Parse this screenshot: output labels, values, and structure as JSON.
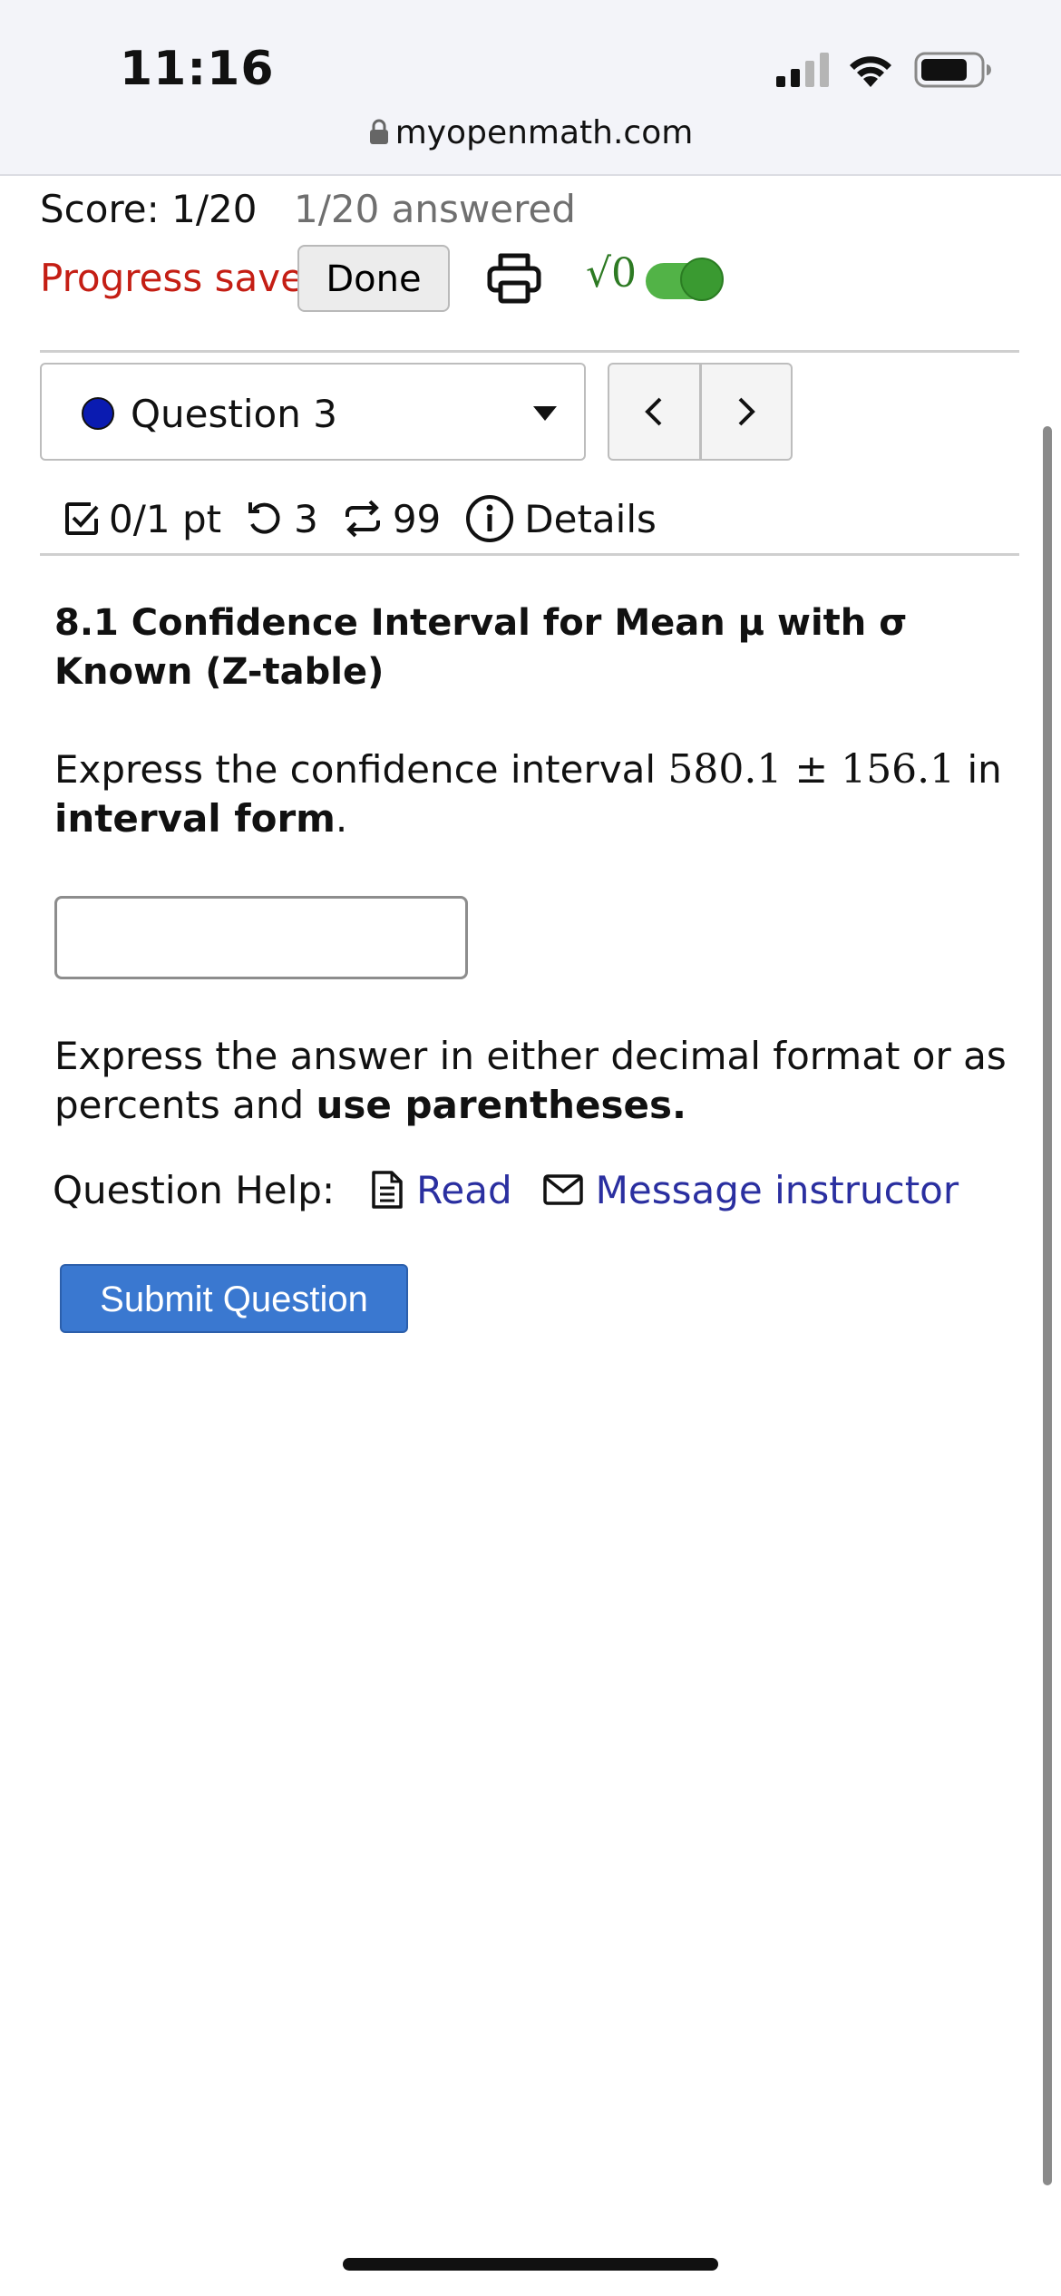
{
  "status_bar": {
    "time": "11:16",
    "url": "myopenmath.com",
    "icons": [
      "signal-icon",
      "wifi-icon",
      "battery-icon",
      "lock-icon"
    ]
  },
  "header": {
    "score": "Score: 1/20",
    "answered": "1/20 answered",
    "progress_status": "Progress saved",
    "done_label": "Done",
    "math_toggle_symbol": "√0",
    "math_toggle_on": true,
    "colors": {
      "progress": "#c41e14",
      "toggle": "#52b347"
    }
  },
  "question_nav": {
    "selected": "Question 3",
    "prev_symbol": "<",
    "next_symbol": ">"
  },
  "question_meta": {
    "points": "0/1 pt",
    "retries": "3",
    "attempts": "99",
    "details_label": "Details"
  },
  "question": {
    "title": "8.1 Confidence Interval for Mean μ with σ Known (Z-table)",
    "prompt_prefix": "Express the confidence interval",
    "prompt_math": "580.1 ± 156.1",
    "prompt_middle": "in",
    "prompt_bold": "interval form",
    "prompt_suffix": ".",
    "answer_value": "",
    "note_prefix": "Express the answer in either decimal format or as percents and",
    "note_bold": "use parentheses."
  },
  "help": {
    "label": "Question Help:",
    "read_label": "Read",
    "message_label": "Message instructor"
  },
  "submit_label": "Submit Question"
}
